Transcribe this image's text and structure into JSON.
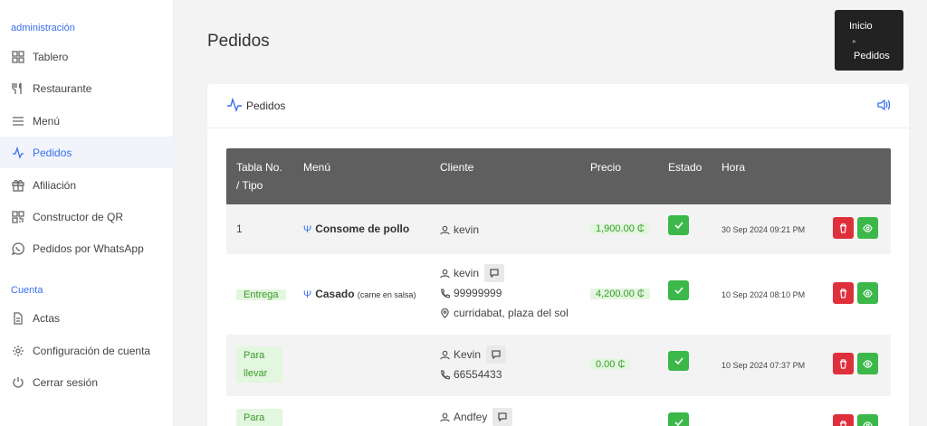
{
  "sidebar": {
    "section1": "administración",
    "items1": [
      {
        "label": "Tablero"
      },
      {
        "label": "Restaurante"
      },
      {
        "label": "Menú"
      },
      {
        "label": "Pedidos"
      },
      {
        "label": "Afiliación"
      },
      {
        "label": "Constructor de QR"
      },
      {
        "label": "Pedidos por WhatsApp"
      }
    ],
    "section2": "Cuenta",
    "items2": [
      {
        "label": "Actas"
      },
      {
        "label": "Configuración de cuenta"
      },
      {
        "label": "Cerrar sesión"
      }
    ]
  },
  "page": {
    "title": "Pedidos"
  },
  "breadcrumb": {
    "home": "Inicio",
    "current": "Pedidos"
  },
  "card": {
    "title": "Pedidos"
  },
  "table": {
    "headers": {
      "tabla_l1": "Tabla No.",
      "tabla_l2": "/ Tipo",
      "menu": "Menú",
      "cliente": "Cliente",
      "precio": "Precio",
      "estado": "Estado",
      "hora": "Hora"
    },
    "rows": [
      {
        "tabla": "1",
        "menu_name": "Consome de pollo",
        "cliente": "kevin",
        "precio": "1,900.00 ₵",
        "hora": "30 Sep 2024 09:21 PM"
      },
      {
        "tipo": "Entrega",
        "menu_name": "Casado",
        "menu_note": "(carne en salsa)",
        "cliente": "kevin",
        "phone": "99999999",
        "address": "curridabat, plaza del sol",
        "precio": "4,200.00 ₵",
        "hora": "10 Sep 2024 08:10 PM"
      },
      {
        "tipo_l1": "Para",
        "tipo_l2": "llevar",
        "cliente": "Kevin",
        "phone": "66554433",
        "precio": "0.00 ₵",
        "hora": "10 Sep 2024 07:37 PM"
      },
      {
        "tipo_l1": "Para",
        "cliente": "Andfey"
      }
    ]
  },
  "colors": {
    "accent": "#3a6ff0",
    "success": "#3cb84a",
    "danger": "#df2f3b",
    "header": "#5f5f5f"
  }
}
